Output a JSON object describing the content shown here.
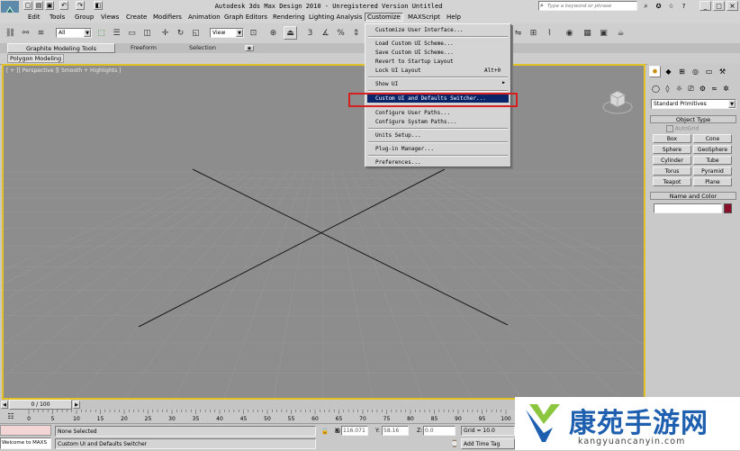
{
  "window": {
    "title": "Autodesk 3ds Max Design 2010  - Unregistered Version  Untitled",
    "app_badge": "MAX",
    "search_placeholder": "Type a keyword or phrase",
    "controls": [
      "_",
      "□",
      "×"
    ]
  },
  "menubar": {
    "items": [
      "Edit",
      "Tools",
      "Group",
      "Views",
      "Create",
      "Modifiers",
      "Animation",
      "Graph Editors",
      "Rendering",
      "Lighting Analysis",
      "Customize",
      "MAXScript",
      "Help"
    ],
    "active": "Customize"
  },
  "toolbar": {
    "selection_filter": "All",
    "reference_coord": "View",
    "snap_labels": [
      "3",
      "%"
    ]
  },
  "ribbon": {
    "tabs": [
      "Graphite Modeling Tools",
      "Freeform",
      "Selection"
    ],
    "panel_label": "Polygon Modeling"
  },
  "viewport": {
    "label": "[ + ][ Perspective ][ Smooth + Highlights ]"
  },
  "customize_menu": {
    "items": [
      {
        "label": "Customize User Interface...",
        "shortcut": ""
      },
      {
        "label": "Load Custom UI Scheme...",
        "shortcut": ""
      },
      {
        "label": "Save Custom UI Scheme...",
        "shortcut": ""
      },
      {
        "label": "Revert to Startup Layout",
        "shortcut": ""
      },
      {
        "label": "Lock UI Layout",
        "shortcut": "Alt+0"
      },
      {
        "label": "Show UI",
        "shortcut": "▶"
      },
      {
        "label": "Custom UI and Defaults Switcher...",
        "shortcut": ""
      },
      {
        "label": "Configure User Paths...",
        "shortcut": ""
      },
      {
        "label": "Configure System Paths...",
        "shortcut": ""
      },
      {
        "label": "Units Setup...",
        "shortcut": ""
      },
      {
        "label": "Plug-in Manager...",
        "shortcut": ""
      },
      {
        "label": "Preferences...",
        "shortcut": ""
      }
    ],
    "highlighted": "Custom UI and Defaults Switcher..."
  },
  "command_panel": {
    "category": "Standard Primitives",
    "object_type_title": "Object Type",
    "autogrid": "AutoGrid",
    "objects": [
      "Box",
      "Cone",
      "Sphere",
      "GeoSphere",
      "Cylinder",
      "Tube",
      "Torus",
      "Pyramid",
      "Teapot",
      "Plane"
    ],
    "name_color_title": "Name and Color",
    "object_color": "#8a0f2a"
  },
  "timeline": {
    "frame_display": "0 / 100",
    "ticks": [
      "0",
      "5",
      "10",
      "15",
      "20",
      "25",
      "30",
      "35",
      "40",
      "45",
      "50",
      "55",
      "60",
      "65",
      "70",
      "75",
      "80",
      "85",
      "90",
      "95",
      "100"
    ]
  },
  "status": {
    "selection": "None Selected",
    "prompt": "Custom UI and Defaults Switcher",
    "maxscript": "Welcome to MAXS",
    "x_label": "X:",
    "x_value": "116.071",
    "y_label": "Y:",
    "y_value": "58.16",
    "z_label": "Z:",
    "z_value": "0.0",
    "grid": "Grid = 10.0",
    "add_time_tag": "Add Time Tag"
  },
  "watermark": {
    "title": "康苑手游网",
    "url": "kangyuancanyin.com"
  },
  "colors": {
    "viewport_bg": "#8d8d8d",
    "active_border": "#e3c226",
    "menu_highlight": "#0a246a",
    "annotation_red": "#d42020",
    "watermark_blue": "#1e5fb0",
    "watermark_green": "#8cc63e"
  }
}
